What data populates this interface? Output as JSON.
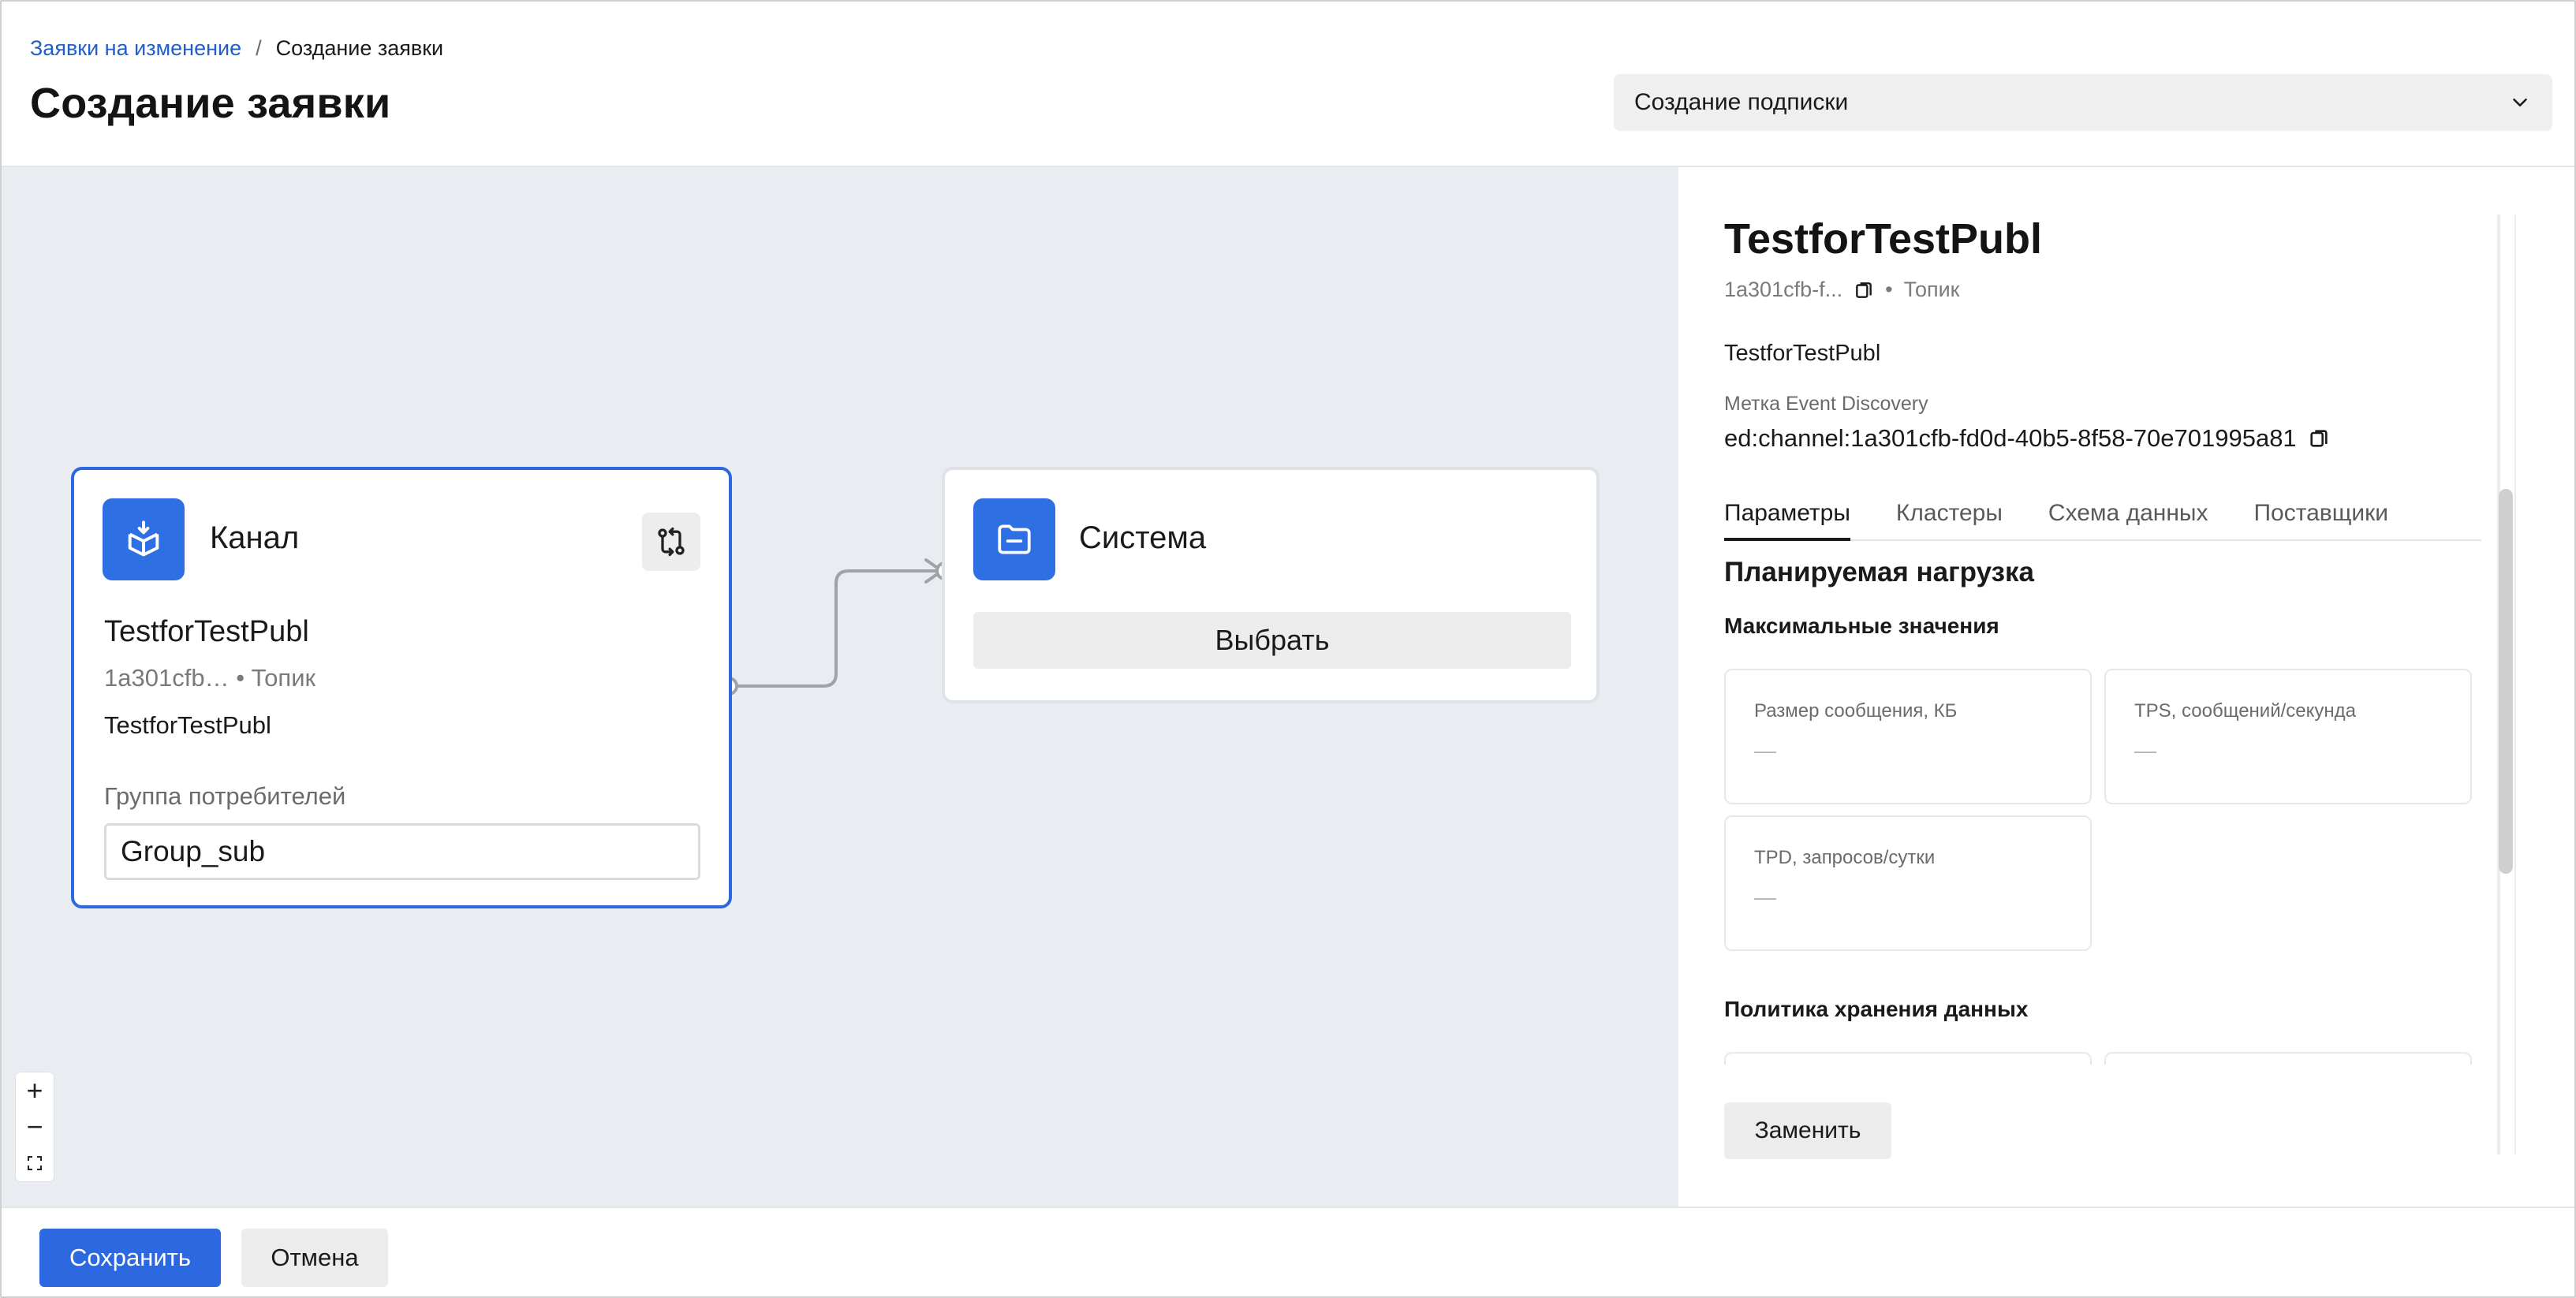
{
  "breadcrumb": {
    "parent": "Заявки на изменение",
    "separator": "/",
    "current": "Создание заявки"
  },
  "page_title": "Создание заявки",
  "request_type_select": {
    "value": "Создание подписки"
  },
  "canvas": {
    "channel_node": {
      "title": "Канал",
      "name": "TestforTestPubl",
      "id_short": "1a301cfb…",
      "type": "Топик",
      "meta_separator": "•",
      "description": "TestforTestPubl",
      "group_label": "Группа потребителей",
      "group_value": "Group_sub"
    },
    "system_node": {
      "title": "Система",
      "select_label": "Выбрать"
    },
    "zoom": {
      "zoom_in": "+",
      "zoom_out": "−"
    }
  },
  "panel": {
    "title": "TestforTestPubl",
    "id_short": "1a301cfb-f...",
    "meta_separator": "•",
    "type": "Топик",
    "description": "TestforTestPubl",
    "ed_label": "Метка Event Discovery",
    "ed_value": "ed:channel:1a301cfb-fd0d-40b5-8f58-70e701995a81",
    "tabs": [
      {
        "label": "Параметры",
        "active": true
      },
      {
        "label": "Кластеры",
        "active": false
      },
      {
        "label": "Схема данных",
        "active": false
      },
      {
        "label": "Поставщики",
        "active": false
      }
    ],
    "load_section": "Планируемая нагрузка",
    "max_values_label": "Максимальные значения",
    "metrics": [
      {
        "label": "Размер сообщения, КБ",
        "value": "—"
      },
      {
        "label": "TPS, сообщений/секунда",
        "value": "—"
      },
      {
        "label": "TPD, запросов/сутки",
        "value": "—"
      }
    ],
    "retention_label": "Политика хранения данных",
    "replace_label": "Заменить"
  },
  "footer": {
    "save_label": "Сохранить",
    "cancel_label": "Отмена"
  },
  "colors": {
    "accent": "#2c68df",
    "node_icon": "#2f6fe4",
    "canvas_bg": "#e9edf2"
  },
  "icons": {
    "channel_node": "package-download-icon",
    "system_node": "folder-icon",
    "swap": "swap-arrows-icon",
    "copy": "copy-icon",
    "dropdown": "chevron-down-icon",
    "fit": "fit-screen-icon"
  }
}
